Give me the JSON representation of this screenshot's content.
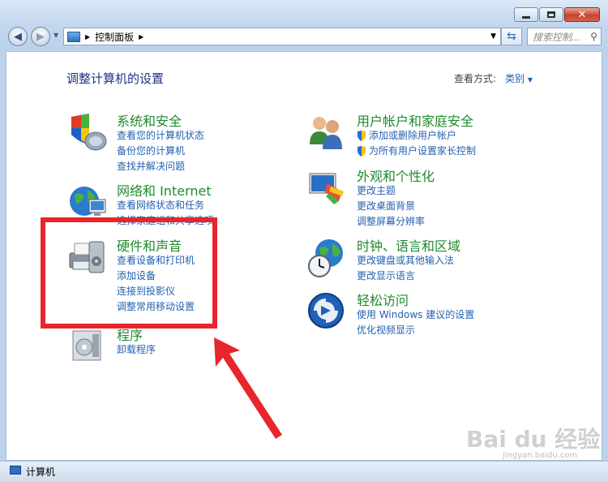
{
  "window": {
    "minimize_label": "",
    "maximize_label": "",
    "close_label": ""
  },
  "address": {
    "path": "控制面板",
    "search_placeholder": "搜索控制..."
  },
  "heading": "调整计算机的设置",
  "view": {
    "label": "查看方式:",
    "value": "类别"
  },
  "categories": {
    "system": {
      "title": "系统和安全",
      "links": [
        "查看您的计算机状态",
        "备份您的计算机",
        "查找并解决问题"
      ]
    },
    "network": {
      "title": "网络和 Internet",
      "links": [
        "查看网络状态和任务",
        "选择家庭组和共享选项"
      ]
    },
    "hardware": {
      "title": "硬件和声音",
      "links": [
        "查看设备和打印机",
        "添加设备",
        "连接到投影仪",
        "调整常用移动设置"
      ]
    },
    "programs": {
      "title": "程序",
      "links": [
        "卸载程序"
      ]
    },
    "users": {
      "title": "用户帐户和家庭安全",
      "links": [
        "添加或删除用户帐户",
        "为所有用户设置家长控制"
      ]
    },
    "appearance": {
      "title": "外观和个性化",
      "links": [
        "更改主题",
        "更改桌面背景",
        "调整屏幕分辨率"
      ]
    },
    "clock": {
      "title": "时钟、语言和区域",
      "links": [
        "更改键盘或其他输入法",
        "更改显示语言"
      ]
    },
    "ease": {
      "title": "轻松访问",
      "links": [
        "使用 Windows 建议的设置",
        "优化视频显示"
      ]
    }
  },
  "statusbar": {
    "text": "计算机"
  },
  "watermark": {
    "text": "Bai du 经验",
    "url": "jingyan.baidu.com"
  },
  "colors": {
    "accent": "#1e8a2e",
    "link": "#2460b0",
    "annotation": "#e8252c"
  }
}
